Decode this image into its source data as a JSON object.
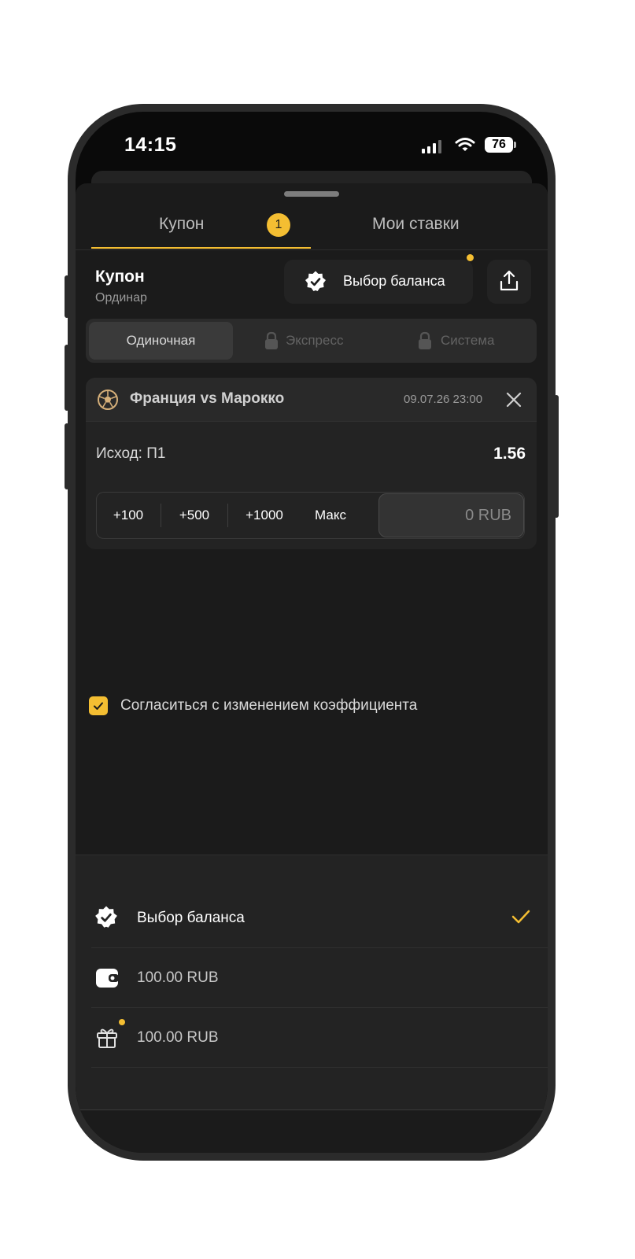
{
  "status_bar": {
    "time": "14:15",
    "battery": "76"
  },
  "tabs": {
    "coupon_label": "Купон",
    "coupon_badge": "1",
    "my_bets_label": "Мои ставки"
  },
  "coupon_header": {
    "title": "Купон",
    "subtitle": "Ординар",
    "balance_button_label": "Выбор баланса"
  },
  "bet_type_tabs": [
    {
      "label": "Одиночная",
      "active": true,
      "locked": false
    },
    {
      "label": "Экспресс",
      "active": false,
      "locked": true
    },
    {
      "label": "Система",
      "active": false,
      "locked": true
    }
  ],
  "event": {
    "title": "Франция vs Марокко",
    "datetime": "09.07.26 23:00",
    "outcome_label": "Исход: П1",
    "odds": "1.56"
  },
  "quick_amounts": [
    "+100",
    "+500",
    "+1000",
    "Макс"
  ],
  "amount_input": {
    "placeholder": "0 RUB"
  },
  "accept_odds": {
    "label": "Согласиться с изменением коэффициента",
    "checked": true
  },
  "balance_options": [
    {
      "label": "Выбор баланса",
      "icon": "gear-check-icon",
      "selected": true
    },
    {
      "label": "100.00 RUB",
      "icon": "wallet-icon",
      "selected": false
    },
    {
      "label": "100.00 RUB",
      "icon": "gift-icon",
      "selected": false
    }
  ],
  "colors": {
    "accent": "#f4be32",
    "background": "#1b1b1b",
    "surface": "#232323"
  }
}
